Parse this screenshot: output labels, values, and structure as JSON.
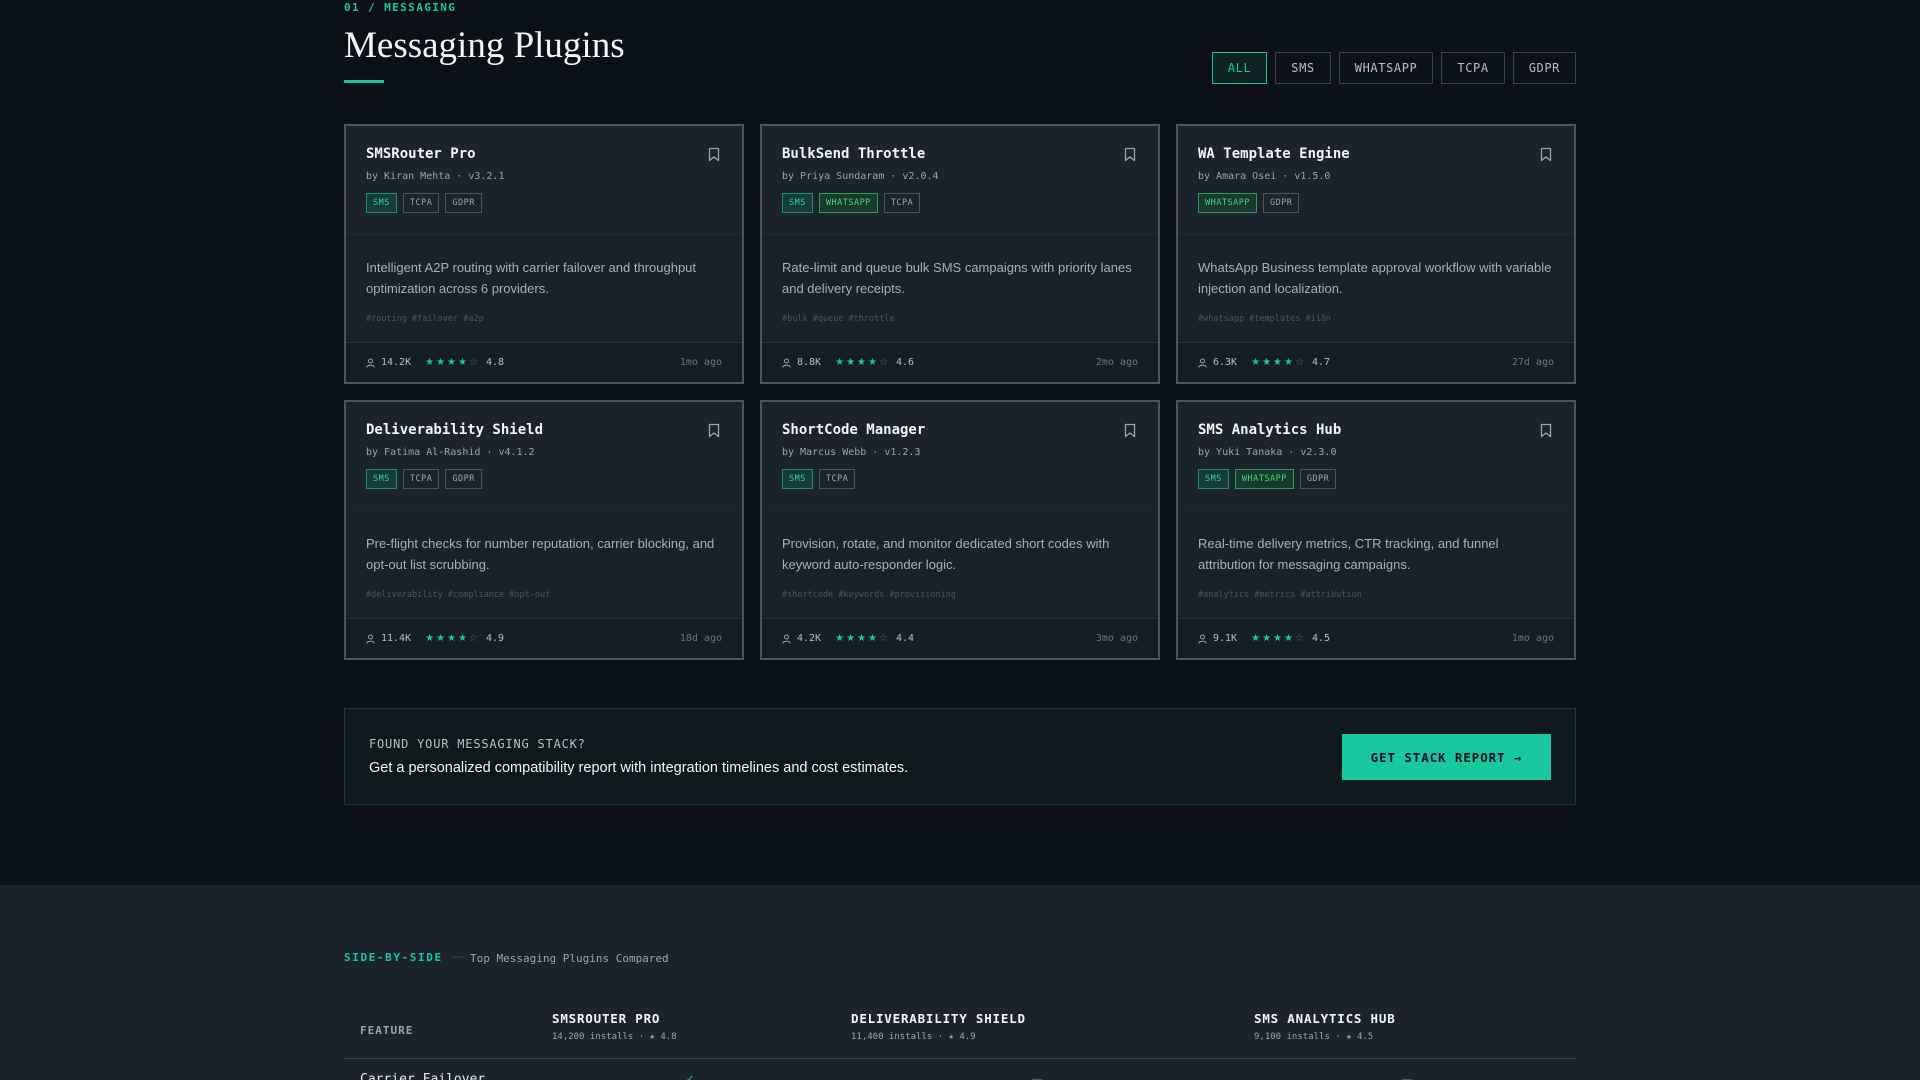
{
  "header": {
    "eyebrow": "01 / MESSAGING",
    "title": "Messaging Plugins"
  },
  "filters": [
    "ALL",
    "SMS",
    "WHATSAPP",
    "TCPA",
    "GDPR"
  ],
  "active_filter": "ALL",
  "cards": [
    {
      "name": "SMSRouter Pro",
      "meta": "by Kiran Mehta · v3.2.1",
      "tags": [
        "SMS",
        "TCPA",
        "GDPR"
      ],
      "description": "Intelligent A2P routing with carrier failover and throughput optimization across 6 providers.",
      "hashtags": "#routing #failover #a2p",
      "installs": "14.2K",
      "stars": 4,
      "rating": "4.8",
      "updated": "1mo ago"
    },
    {
      "name": "BulkSend Throttle",
      "meta": "by Priya Sundaram · v2.0.4",
      "tags": [
        "SMS",
        "WHATSAPP",
        "TCPA"
      ],
      "description": "Rate-limit and queue bulk SMS campaigns with priority lanes and delivery receipts.",
      "hashtags": "#bulk #queue #throttle",
      "installs": "8.8K",
      "stars": 4,
      "rating": "4.6",
      "updated": "2mo ago"
    },
    {
      "name": "WA Template Engine",
      "meta": "by Amara Osei · v1.5.0",
      "tags": [
        "WHATSAPP",
        "GDPR"
      ],
      "description": "WhatsApp Business template approval workflow with variable injection and localization.",
      "hashtags": "#whatsapp #templates #i18n",
      "installs": "6.3K",
      "stars": 4,
      "rating": "4.7",
      "updated": "27d ago"
    },
    {
      "name": "Deliverability Shield",
      "meta": "by Fatima Al-Rashid · v4.1.2",
      "tags": [
        "SMS",
        "TCPA",
        "GDPR"
      ],
      "description": "Pre-flight checks for number reputation, carrier blocking, and opt-out list scrubbing.",
      "hashtags": "#deliverability #compliance #opt-out",
      "installs": "11.4K",
      "stars": 4,
      "rating": "4.9",
      "updated": "18d ago"
    },
    {
      "name": "ShortCode Manager",
      "meta": "by Marcus Webb · v1.2.3",
      "tags": [
        "SMS",
        "TCPA"
      ],
      "description": "Provision, rotate, and monitor dedicated short codes with keyword auto-responder logic.",
      "hashtags": "#shortcode #keywords #provisioning",
      "installs": "4.2K",
      "stars": 4,
      "rating": "4.4",
      "updated": "3mo ago"
    },
    {
      "name": "SMS Analytics Hub",
      "meta": "by Yuki Tanaka · v2.3.0",
      "tags": [
        "SMS",
        "WHATSAPP",
        "GDPR"
      ],
      "description": "Real-time delivery metrics, CTR tracking, and funnel attribution for messaging campaigns.",
      "hashtags": "#analytics #metrics #attribution",
      "installs": "9.1K",
      "stars": 4,
      "rating": "4.5",
      "updated": "1mo ago"
    }
  ],
  "cta": {
    "eyebrow": "FOUND YOUR MESSAGING STACK?",
    "text": "Get a personalized compatibility report with integration timelines and cost estimates.",
    "button": "GET STACK REPORT →"
  },
  "comparison": {
    "eyebrow": "SIDE-BY-SIDE",
    "separator": "—",
    "subtitle": "Top Messaging Plugins Compared",
    "feature_label": "FEATURE",
    "columns": [
      {
        "name": "SMSROUTER PRO",
        "meta": "14,200 installs · ★ 4.8"
      },
      {
        "name": "DELIVERABILITY SHIELD",
        "meta": "11,400 installs · ★ 4.9"
      },
      {
        "name": "SMS ANALYTICS HUB",
        "meta": "9,100 installs · ★ 4.5"
      }
    ],
    "first_row": {
      "feature": "Carrier Failover",
      "cells": [
        "✓",
        "—",
        "—"
      ]
    }
  },
  "colors": {
    "accent": "#17c7a1",
    "background": "#0d1117",
    "card": "#1c232d"
  },
  "icons": {
    "bookmark": "bookmark-icon",
    "user": "user-icon",
    "star": "star-icon"
  }
}
